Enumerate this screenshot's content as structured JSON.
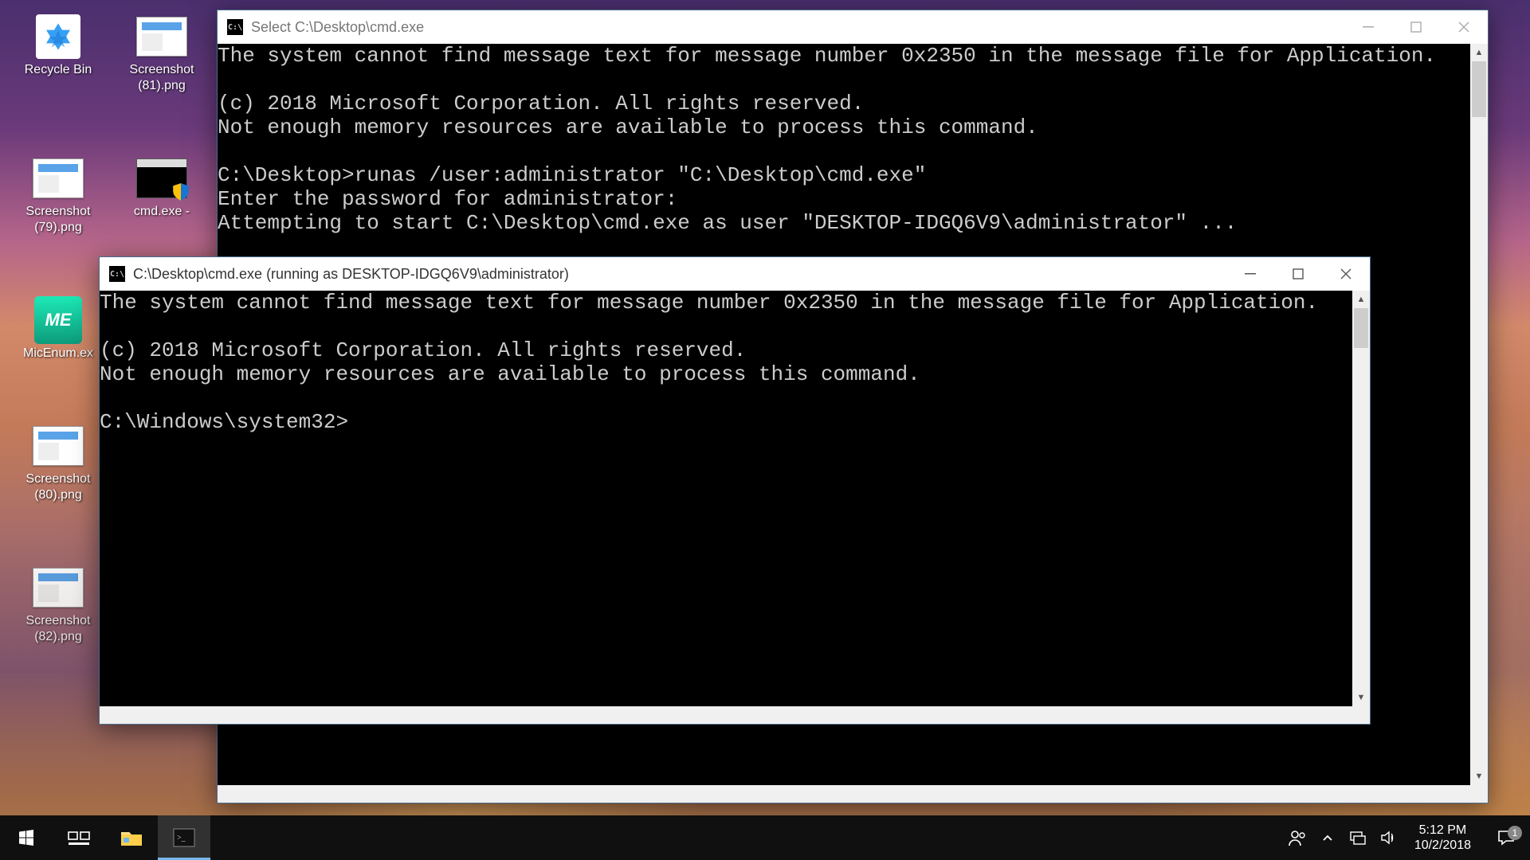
{
  "desktop_icons": {
    "recycle_bin": "Recycle Bin",
    "screenshot81": "Screenshot (81).png",
    "screenshot79": "Screenshot (79).png",
    "cmd_shortcut": "cmd.exe - ",
    "micenum": "MicEnum.ex",
    "screenshot80": "Screenshot (80).png",
    "screenshot82": "Screenshot (82).png",
    "me_label": "ME"
  },
  "win_back": {
    "title": "Select C:\\Desktop\\cmd.exe",
    "icon_text": "C:\\",
    "lines": "The system cannot find message text for message number 0x2350 in the message file for Application.\n\n(c) 2018 Microsoft Corporation. All rights reserved.\nNot enough memory resources are available to process this command.\n\nC:\\Desktop>runas /user:administrator \"C:\\Desktop\\cmd.exe\"\nEnter the password for administrator:\nAttempting to start C:\\Desktop\\cmd.exe as user \"DESKTOP-IDGQ6V9\\administrator\" ..."
  },
  "win_front": {
    "title": "C:\\Desktop\\cmd.exe (running as DESKTOP-IDGQ6V9\\administrator)",
    "icon_text": "C:\\",
    "lines": "The system cannot find message text for message number 0x2350 in the message file for Application.\n\n(c) 2018 Microsoft Corporation. All rights reserved.\nNot enough memory resources are available to process this command.\n\nC:\\Windows\\system32>"
  },
  "taskbar": {
    "time": "5:12 PM",
    "date": "10/2/2018",
    "notif_count": "1"
  },
  "colors": {
    "terminal_fg": "#cccccc",
    "terminal_bg": "#000000",
    "titlebar_bg": "#ffffff"
  }
}
